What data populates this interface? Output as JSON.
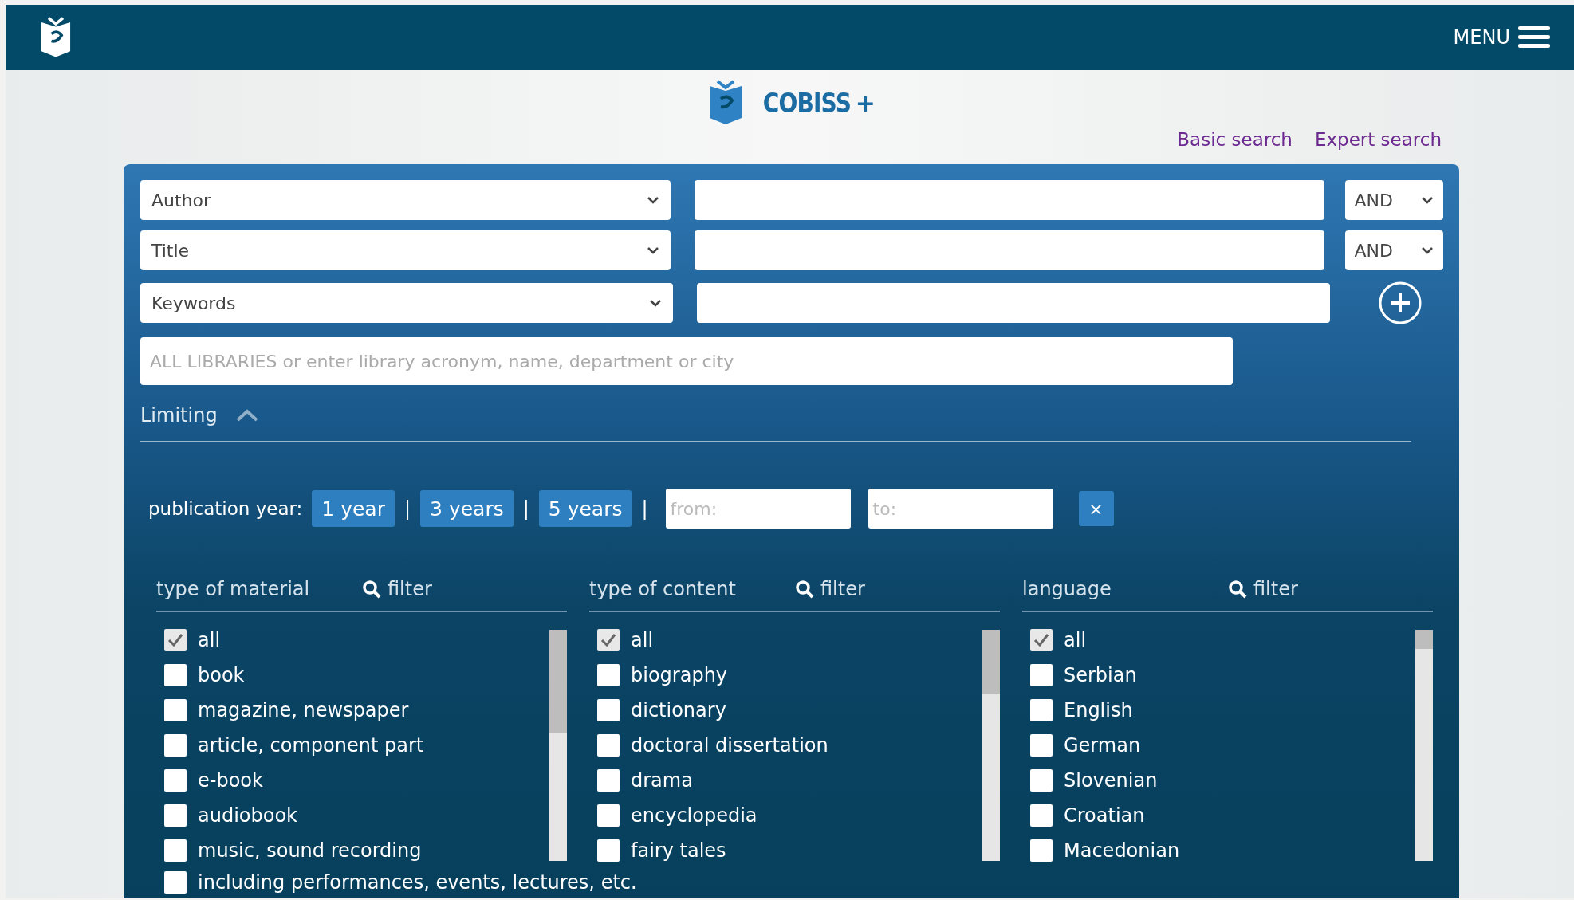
{
  "header": {
    "menu_label": "MENU"
  },
  "brand": {
    "name": "COBISS",
    "mark": "+"
  },
  "search_modes": [
    {
      "label": "Basic search",
      "selected": false
    },
    {
      "label": "Expert search",
      "selected": false
    }
  ],
  "search_rows": [
    {
      "field": "Author",
      "value": "",
      "operator": "AND"
    },
    {
      "field": "Title",
      "value": "",
      "operator": "AND"
    },
    {
      "field": "Keywords",
      "value": ""
    }
  ],
  "library": {
    "placeholder": "ALL LIBRARIES or enter library acronym, name, department or city"
  },
  "limiting": {
    "label": "Limiting",
    "expanded": true
  },
  "publication_year": {
    "label": "publication year:",
    "separator": "|",
    "ranges": [
      "1 year",
      "3 years",
      "5 years"
    ],
    "from_placeholder": "from:",
    "to_placeholder": "to:",
    "clear": "×"
  },
  "facets": [
    {
      "title": "type of material",
      "filter": "filter",
      "items": [
        {
          "label": "all",
          "checked": true
        },
        {
          "label": "book",
          "checked": false
        },
        {
          "label": "magazine, newspaper",
          "checked": false
        },
        {
          "label": "article, component part",
          "checked": false
        },
        {
          "label": "e-book",
          "checked": false
        },
        {
          "label": "audiobook",
          "checked": false
        },
        {
          "label": "music, sound recording",
          "checked": false
        }
      ]
    },
    {
      "title": "type of content",
      "filter": "filter",
      "items": [
        {
          "label": "all",
          "checked": true
        },
        {
          "label": "biography",
          "checked": false
        },
        {
          "label": "dictionary",
          "checked": false
        },
        {
          "label": "doctoral dissertation",
          "checked": false
        },
        {
          "label": "drama",
          "checked": false
        },
        {
          "label": "encyclopedia",
          "checked": false
        },
        {
          "label": "fairy tales",
          "checked": false
        }
      ]
    },
    {
      "title": "language",
      "filter": "filter",
      "items": [
        {
          "label": "all",
          "checked": true
        },
        {
          "label": "Serbian",
          "checked": false
        },
        {
          "label": "English",
          "checked": false
        },
        {
          "label": "German",
          "checked": false
        },
        {
          "label": "Slovenian",
          "checked": false
        },
        {
          "label": "Croatian",
          "checked": false
        },
        {
          "label": "Macedonian",
          "checked": false
        }
      ]
    }
  ],
  "extra_option": {
    "label": "including performances, events, lectures, etc.",
    "checked": false
  }
}
